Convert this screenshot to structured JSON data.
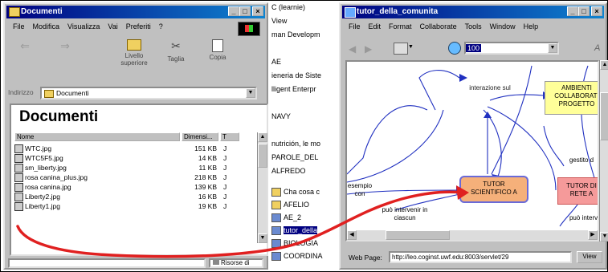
{
  "explorer": {
    "title": "Documenti",
    "menu": [
      "File",
      "Modifica",
      "Visualizza",
      "Vai",
      "Preferiti",
      "?"
    ],
    "toolbar": [
      {
        "label": "",
        "icon": "back-arrow-icon"
      },
      {
        "label": "",
        "icon": "forward-arrow-icon"
      },
      {
        "label": "Livello superiore",
        "icon": "up-folder-icon"
      },
      {
        "label": "Taglia",
        "icon": "scissors-icon"
      },
      {
        "label": "Copia",
        "icon": "copy-icon"
      }
    ],
    "address_label": "Indirizzo",
    "address_value": "Documenti",
    "heading": "Documenti",
    "columns": [
      "Nome",
      "Dimensi...",
      "T"
    ],
    "files": [
      {
        "name": "WTC.jpg",
        "size": "151 KB",
        "type": "J"
      },
      {
        "name": "WTC5F5.jpg",
        "size": "14 KB",
        "type": "J"
      },
      {
        "name": "sm_liberty.jpg",
        "size": "11 KB",
        "type": "J"
      },
      {
        "name": "rosa canina_plus.jpg",
        "size": "218 KB",
        "type": "J"
      },
      {
        "name": "rosa canina.jpg",
        "size": "139 KB",
        "type": "J"
      },
      {
        "name": "Liberty2.jpg",
        "size": "16 KB",
        "type": "J"
      },
      {
        "name": "Liberty1.jpg",
        "size": "19 KB",
        "type": "J"
      }
    ],
    "status_right": "Risorse di"
  },
  "middle": {
    "lines": [
      "C (learnie)",
      "View",
      "man Developm",
      "",
      "AE",
      "ieneria de Siste",
      "lligent Enterpr",
      "",
      "NAVY",
      "",
      "nutrición, le mo",
      "PAROLE_DEL",
      "ALFREDO"
    ],
    "items": [
      {
        "label": "Cha cosa c",
        "icon": "folder-icon"
      },
      {
        "label": "AFELIO",
        "icon": "folder-icon"
      },
      {
        "label": "AE_2",
        "icon": "network-icon"
      },
      {
        "label": "tutor_della",
        "icon": "network-icon",
        "selected": true
      },
      {
        "label": "BIOLOGIA",
        "icon": "network-icon"
      },
      {
        "label": "COORDINA",
        "icon": "network-icon"
      }
    ]
  },
  "cmap": {
    "title": "tutor_della_comunita",
    "menu": [
      "File",
      "Edit",
      "Format",
      "Collaborate",
      "Tools",
      "Window",
      "Help"
    ],
    "zoom": "100",
    "nodes": [
      {
        "id": "interazione",
        "text": "interazione sul"
      },
      {
        "id": "ambienti",
        "text": "AMBIENTI COLLABORATI PROGETTO"
      },
      {
        "id": "tutor_sci",
        "text": "TUTOR SCIENTIFICO A"
      },
      {
        "id": "tutor_rete",
        "text": "TUTOR DI RETE A"
      },
      {
        "id": "gestito",
        "text": "gestito d"
      },
      {
        "id": "esempio",
        "text": "esempio con"
      },
      {
        "id": "puo",
        "text": "può intervenir in ciascun"
      },
      {
        "id": "puo2",
        "text": "può interven"
      }
    ],
    "status_label": "Web Page:",
    "status_url": "http://leo.coginst.uwf.edu:8003/servlet/29",
    "status_button": "View"
  },
  "colors": {
    "title_bar": "#000080",
    "annotation": "#e02020",
    "node_orange": "#f5b07a",
    "node_yellow": "#ffff99",
    "node_pink": "#f59a9a",
    "link_blue": "#2030c0"
  }
}
